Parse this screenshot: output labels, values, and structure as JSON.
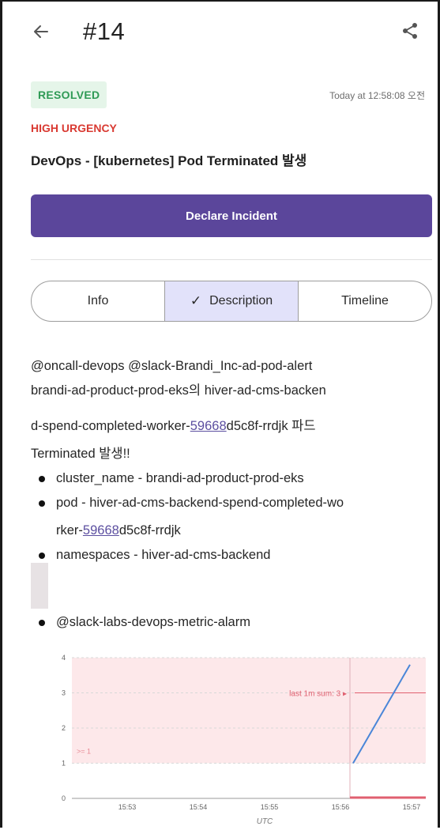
{
  "header": {
    "title": "#14",
    "back_icon": "arrow-left-icon",
    "share_icon": "share-icon"
  },
  "status": {
    "badge": "RESOLVED",
    "timestamp": "Today at 12:58:08 오전",
    "badge_color": "#2f9a55"
  },
  "urgency": "HIGH URGENCY",
  "subject": "DevOps - [kubernetes] Pod Terminated 발생",
  "declare_button": "Declare Incident",
  "tabs": [
    {
      "label": "Info"
    },
    {
      "label": "Description",
      "active": true
    },
    {
      "label": "Timeline"
    }
  ],
  "description": {
    "line1": "@oncall-devops @slack-Brandi_Inc-ad-pod-alert",
    "line2": "brandi-ad-product-prod-eks의 hiver-ad-cms-backen",
    "line3_pre": "d-spend-completed-worker-",
    "line3_link": "59668",
    "line3_post": "d5c8f-rrdjk 파드",
    "line4": "Terminated 발생!!",
    "bullet1": "cluster_name - brandi-ad-product-prod-eks",
    "bullet2": "pod - hiver-ad-cms-backend-spend-completed-wo",
    "bullet2_cont_pre": "rker-",
    "bullet2_cont_link": "59668",
    "bullet2_cont_post": "d5c8f-rrdjk",
    "bullet3": "namespaces - hiver-ad-cms-backend",
    "bullet4": "@slack-labs-devops-metric-alarm"
  },
  "chart_data": {
    "type": "line",
    "xlabel": "UTC",
    "x_ticks": [
      "15:53",
      "15:54",
      "15:55",
      "15:56",
      "15:57"
    ],
    "y_ticks": [
      "0",
      "1",
      "2",
      "3",
      "4"
    ],
    "ylim": [
      0,
      4
    ],
    "threshold_label": ">= 1",
    "annotation": "last 1m sum: 3",
    "series": [
      {
        "x": [
          "15:56",
          "15:57"
        ],
        "values": [
          1,
          3.8
        ]
      }
    ],
    "colors": {
      "line": "#4a86d8",
      "threshold_band": "#fde8ea",
      "marker": "#e06070"
    }
  }
}
